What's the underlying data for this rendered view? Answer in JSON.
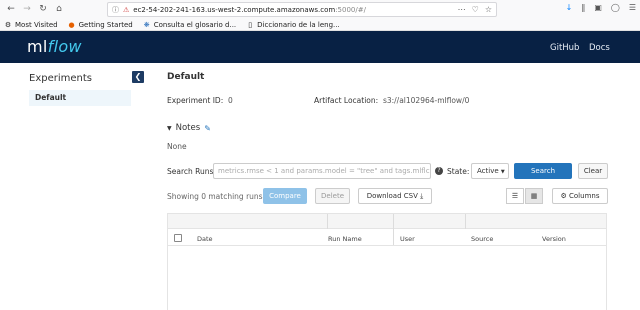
{
  "browser": {
    "url_host": "ec2-54-202-241-163.us-west-2.compute.amazonaws.com",
    "url_rest": ":5000/#/",
    "bookmarks": [
      {
        "label": "Most Visited",
        "icon": "gear-icon"
      },
      {
        "label": "Getting Started",
        "icon": "firefox-icon"
      },
      {
        "label": "Consulta el glosario d...",
        "icon": "globe-icon"
      },
      {
        "label": "Diccionario de la leng...",
        "icon": "page-icon"
      }
    ]
  },
  "header": {
    "logo_ml": "ml",
    "logo_flow": "flow",
    "links": [
      "GitHub",
      "Docs"
    ],
    "bg_color": "#082144",
    "accent_color": "#43c9ed"
  },
  "sidebar": {
    "title": "Experiments",
    "collapse_icon": "chevron-left-icon",
    "items": [
      {
        "label": "Default",
        "selected": true
      }
    ]
  },
  "experiment": {
    "name": "Default",
    "id_label": "Experiment ID:",
    "id_value": "0",
    "artifact_label": "Artifact Location:",
    "artifact_value": "s3://al102964-mlflow/0",
    "notes_label": "Notes",
    "notes_value": "None"
  },
  "search": {
    "label": "Search Runs:",
    "placeholder": "metrics.rmse < 1 and params.model = \"tree\" and tags.mlflc",
    "state_label": "State:",
    "state_value": "Active",
    "search_button": "Search",
    "clear_button": "Clear"
  },
  "runs": {
    "showing_text": "Showing 0 matching runs",
    "compare_button": "Compare",
    "delete_button": "Delete",
    "download_button": "Download CSV",
    "columns_button": "Columns",
    "table_headers": [
      "Date",
      "Run Name",
      "User",
      "Source",
      "Version"
    ]
  }
}
